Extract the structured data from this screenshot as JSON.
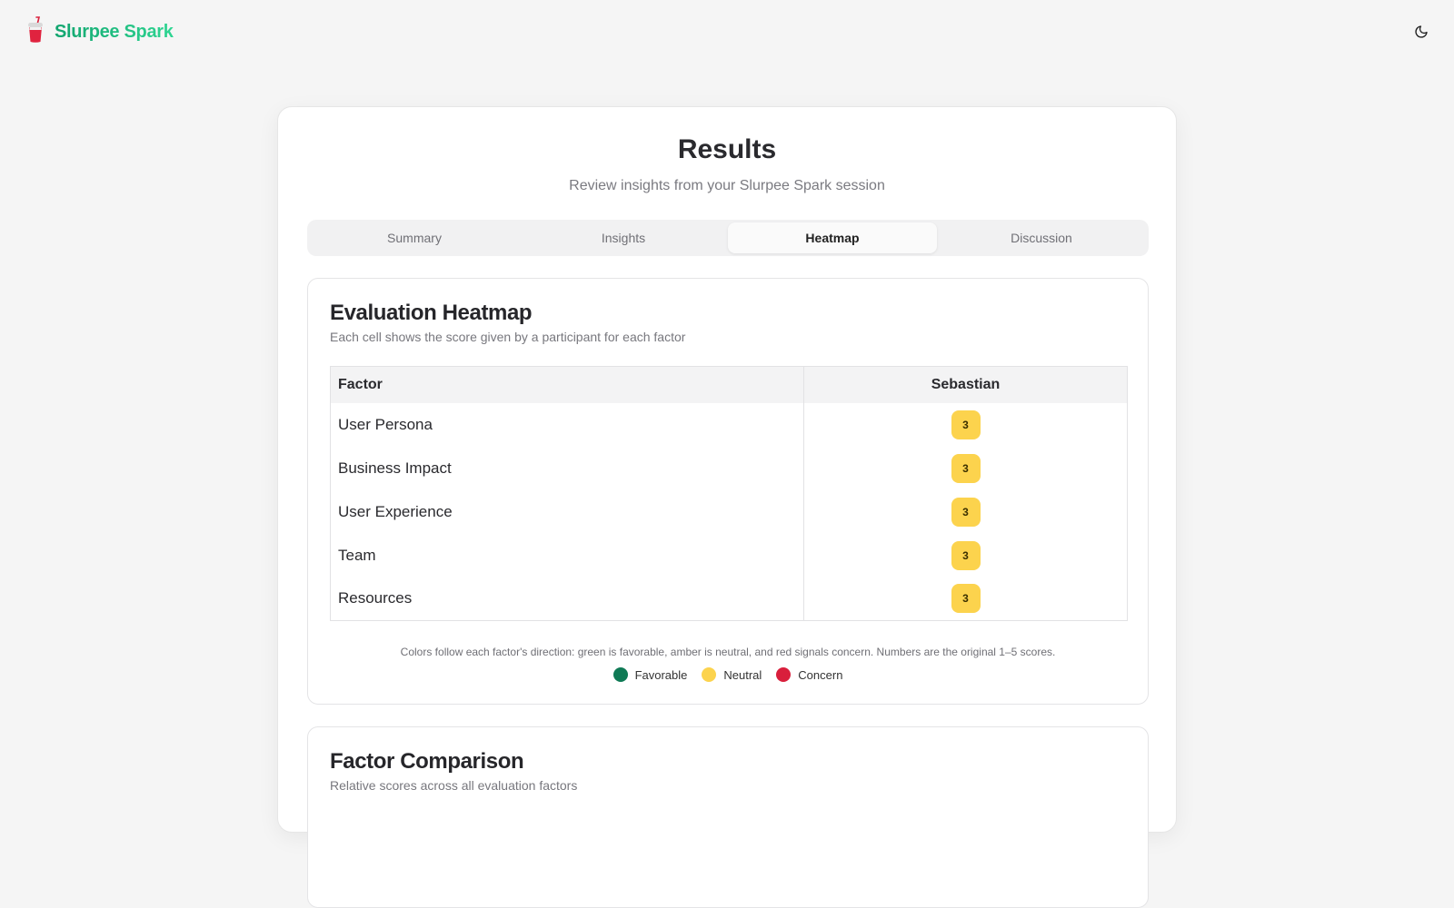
{
  "app": {
    "name": "Slurpee Spark",
    "brand_gradient": [
      "#12a56f",
      "#2fd592"
    ],
    "logo_icon": "slurpee-cup-icon",
    "theme_toggle_icon": "moon-icon"
  },
  "results": {
    "title": "Results",
    "subtitle": "Review insights from your Slurpee Spark session",
    "tabs": [
      {
        "label": "Summary",
        "active": false
      },
      {
        "label": "Insights",
        "active": false
      },
      {
        "label": "Heatmap",
        "active": true
      },
      {
        "label": "Discussion",
        "active": false
      }
    ]
  },
  "heatmap": {
    "title": "Evaluation Heatmap",
    "description": "Each cell shows the score given by a participant for each factor",
    "columns": {
      "factor": "Factor",
      "participant": "Sebastian"
    },
    "rows": [
      {
        "factor": "User Persona",
        "score": "3"
      },
      {
        "factor": "Business Impact",
        "score": "3"
      },
      {
        "factor": "User Experience",
        "score": "3"
      },
      {
        "factor": "Team",
        "score": "3"
      },
      {
        "factor": "Resources",
        "score": "3"
      }
    ],
    "note": "Colors follow each factor's direction: green is favorable, amber is neutral, and red signals concern. Numbers are the original 1–5 scores.",
    "legend": [
      {
        "label": "Favorable",
        "color": "#0f7a55"
      },
      {
        "label": "Neutral",
        "color": "#fcd34d"
      },
      {
        "label": "Concern",
        "color": "#d91f3c"
      }
    ],
    "neutral_color": "#fcd34d"
  },
  "comparison": {
    "title": "Factor Comparison",
    "description": "Relative scores across all evaluation factors"
  }
}
